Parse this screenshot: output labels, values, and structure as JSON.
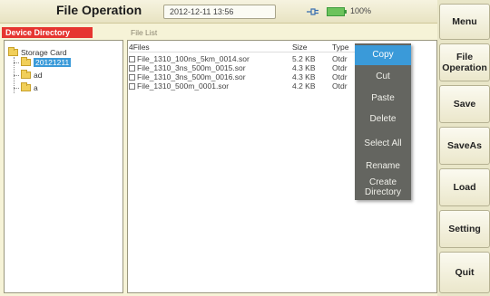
{
  "titlebar": {
    "title": "File Operation",
    "datetime": "2012-12-11 13:56",
    "battery": "100%"
  },
  "directory": {
    "header": "Device Directory",
    "root": "Storage Card",
    "items": [
      "20121211",
      "ad",
      "a"
    ],
    "selected": "20121211"
  },
  "filelist": {
    "header": "File List",
    "count_label": "4Files",
    "col_size": "Size",
    "col_type": "Type",
    "rows": [
      {
        "name": "File_1310_100ns_5km_0014.sor",
        "size": "5.2 KB",
        "type": "Otdr"
      },
      {
        "name": "File_1310_3ns_500m_0015.sor",
        "size": "4.3 KB",
        "type": "Otdr"
      },
      {
        "name": "File_1310_3ns_500m_0016.sor",
        "size": "4.3 KB",
        "type": "Otdr"
      },
      {
        "name": "File_1310_500m_0001.sor",
        "size": "4.2 KB",
        "type": "Otdr"
      }
    ]
  },
  "context_menu": {
    "items": [
      "Copy",
      "Cut",
      "Paste",
      "Delete",
      "Select All",
      "Rename",
      "Create Directory"
    ],
    "active": "Copy"
  },
  "side_menu": {
    "menu": "Menu",
    "file_operation": "File Operation",
    "save": "Save",
    "save_as": "SaveAs",
    "load": "Load",
    "setting": "Setting",
    "quit": "Quit"
  },
  "colors": {
    "accent_blue": "#3a9ad9",
    "header_red": "#e63631",
    "menu_gray": "#646560",
    "background": "#f6f3d7"
  }
}
